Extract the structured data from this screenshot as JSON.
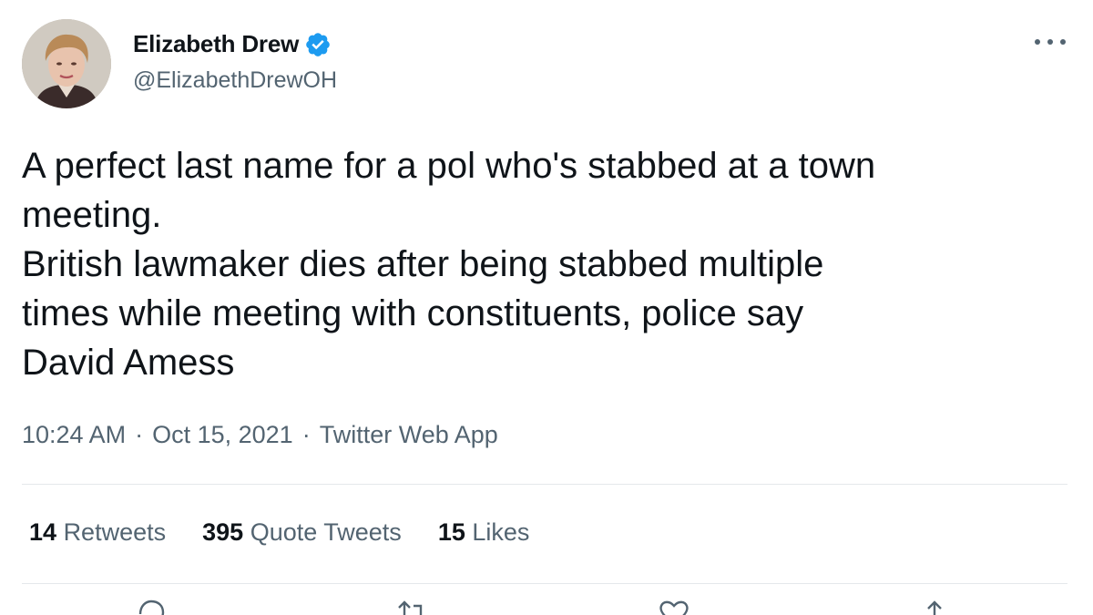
{
  "user": {
    "display_name": "Elizabeth Drew",
    "handle": "@ElizabethDrewOH",
    "verified": true
  },
  "tweet": {
    "lines": [
      "A perfect last name for a pol who's stabbed at a town",
      "meeting.",
      "British lawmaker dies after being stabbed multiple",
      "times while meeting with constituents, police say",
      "David Amess"
    ]
  },
  "meta": {
    "time": "10:24 AM",
    "date": "Oct 15, 2021",
    "source": "Twitter Web App",
    "separator": "·"
  },
  "stats": {
    "retweets": {
      "count": "14",
      "label": "Retweets"
    },
    "quote_tweets": {
      "count": "395",
      "label": "Quote Tweets"
    },
    "likes": {
      "count": "15",
      "label": "Likes"
    }
  },
  "icons": {
    "verified": "verified-badge-icon",
    "more": "more-options-icon",
    "reply": "reply-icon",
    "retweet": "retweet-icon",
    "like": "heart-icon",
    "share": "share-icon"
  },
  "colors": {
    "text": "#0f1419",
    "secondary": "#536471",
    "verified_blue": "#1d9bf0",
    "divider": "#e4e8eb"
  }
}
